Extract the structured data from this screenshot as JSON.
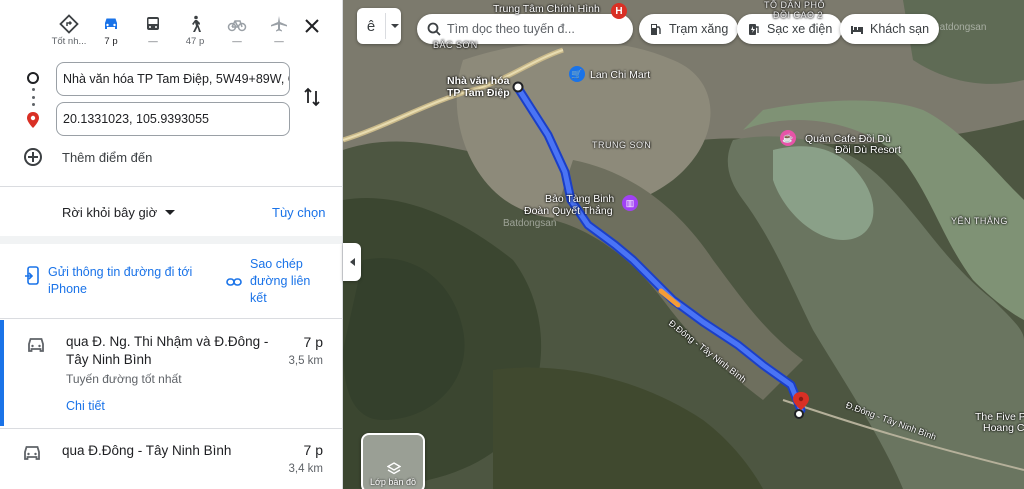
{
  "modes": [
    {
      "name": "best",
      "label": "Tốt nh..."
    },
    {
      "name": "car",
      "label": "7 p"
    },
    {
      "name": "transit",
      "label": "—"
    },
    {
      "name": "walk",
      "label": "47 p"
    },
    {
      "name": "bike",
      "label": "—"
    },
    {
      "name": "flight",
      "label": "—"
    }
  ],
  "origin": "Nhà văn hóa TP Tam Điệp, 5W49+89W, G",
  "destination": "20.1331023, 105.9393055",
  "add_destination": "Thêm điểm đến",
  "leave_now": "Rời khỏi bây giờ",
  "options": "Tùy chọn",
  "send_to_phone": "Gửi thông tin đường đi tới iPhone",
  "copy_link": "Sao chép đường liên kết",
  "routes": [
    {
      "via": "qua Đ. Ng. Thi Nhậm và Đ.Đông - Tây Ninh Bình",
      "duration": "7 p",
      "distance": "3,5 km",
      "note": "Tuyến đường tốt nhất",
      "details": "Chi tiết"
    },
    {
      "via": "qua Đ.Đông - Tây Ninh Bình",
      "duration": "7 p",
      "distance": "3,4 km"
    }
  ],
  "map": {
    "ime_char": "ê",
    "search_placeholder": "Tìm dọc theo tuyến đ...",
    "chips": [
      "Trạm xăng",
      "Sạc xe điện",
      "Khách sạn"
    ],
    "labels": {
      "trung_tam": "Trung Tâm Chính Hình",
      "to_dan_pho": "TỔ DÂN PHỐ",
      "doi_cao": "ĐỒI CAO 2",
      "bac_son": "BẮC SƠN",
      "nha_van_hoa": "Nhà văn hóa",
      "tp_tam_diep": "TP Tam Điệp",
      "lan_chi": "Lan Chi Mart",
      "trung_son": "TRUNG SƠN",
      "quan_cafe": "Quán Cafe Đồi Dù",
      "doi_du": "Đồi Dù Resort",
      "bao_tang": "Bảo Tàng Binh",
      "doan_quyet": "Đoàn Quyết Thắng",
      "yen_thang": "YÊN THẮNG",
      "road1": "Đ.Đông - Tây Ninh Bình",
      "road2": "Đ.Đông - Tây Ninh Bình",
      "five": "The Five P",
      "hoang": "Hoang C",
      "watermark1": "Batdongsan",
      "watermark2": "Batdongsan"
    },
    "layers": "Lớp bản đồ"
  }
}
